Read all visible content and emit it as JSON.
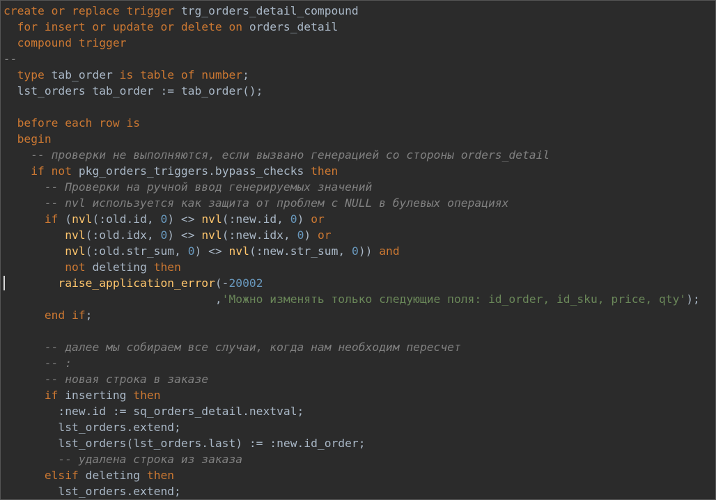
{
  "editor": {
    "language": "plsql",
    "colors": {
      "background": "#2b2b2b",
      "keyword": "#cc7832",
      "identifier": "#a9b7c6",
      "function": "#ffc66d",
      "number": "#6897bb",
      "string": "#6a8759",
      "comment": "#808080"
    },
    "lines": [
      [
        {
          "t": "kw",
          "v": "create or replace trigger "
        },
        {
          "t": "id",
          "v": "trg_orders_detail_compound"
        }
      ],
      [
        {
          "t": "plain",
          "v": "  "
        },
        {
          "t": "kw",
          "v": "for insert or update or delete on "
        },
        {
          "t": "id",
          "v": "orders_detail"
        }
      ],
      [
        {
          "t": "plain",
          "v": "  "
        },
        {
          "t": "kw",
          "v": "compound trigger"
        }
      ],
      [
        {
          "t": "cm",
          "v": "--"
        }
      ],
      [
        {
          "t": "plain",
          "v": "  "
        },
        {
          "t": "kw",
          "v": "type "
        },
        {
          "t": "id",
          "v": "tab_order "
        },
        {
          "t": "kw",
          "v": "is table of number"
        },
        {
          "t": "plain",
          "v": ";"
        }
      ],
      [
        {
          "t": "plain",
          "v": "  "
        },
        {
          "t": "id",
          "v": "lst_orders tab_order := tab_order();"
        }
      ],
      [],
      [
        {
          "t": "plain",
          "v": "  "
        },
        {
          "t": "kw",
          "v": "before each row is"
        }
      ],
      [
        {
          "t": "plain",
          "v": "  "
        },
        {
          "t": "kw",
          "v": "begin"
        }
      ],
      [
        {
          "t": "plain",
          "v": "    "
        },
        {
          "t": "cm",
          "v": "-- проверки не выполняются, если вызвано генерацией со стороны orders_detail"
        }
      ],
      [
        {
          "t": "plain",
          "v": "    "
        },
        {
          "t": "kw",
          "v": "if not "
        },
        {
          "t": "id",
          "v": "pkg_orders_triggers.bypass_checks "
        },
        {
          "t": "kw",
          "v": "then"
        }
      ],
      [
        {
          "t": "plain",
          "v": "      "
        },
        {
          "t": "cm",
          "v": "-- Проверки на ручной ввод генерируемых значений"
        }
      ],
      [
        {
          "t": "plain",
          "v": "      "
        },
        {
          "t": "cm",
          "v": "-- nvl используется как защита от проблем с NULL в булевых операциях"
        }
      ],
      [
        {
          "t": "plain",
          "v": "      "
        },
        {
          "t": "kw",
          "v": "if "
        },
        {
          "t": "plain",
          "v": "("
        },
        {
          "t": "fn",
          "v": "nvl"
        },
        {
          "t": "plain",
          "v": "(:old.id, "
        },
        {
          "t": "num",
          "v": "0"
        },
        {
          "t": "plain",
          "v": ") <> "
        },
        {
          "t": "fn",
          "v": "nvl"
        },
        {
          "t": "plain",
          "v": "(:new.id, "
        },
        {
          "t": "num",
          "v": "0"
        },
        {
          "t": "plain",
          "v": ") "
        },
        {
          "t": "kw",
          "v": "or"
        }
      ],
      [
        {
          "t": "plain",
          "v": "         "
        },
        {
          "t": "fn",
          "v": "nvl"
        },
        {
          "t": "plain",
          "v": "(:old.idx, "
        },
        {
          "t": "num",
          "v": "0"
        },
        {
          "t": "plain",
          "v": ") <> "
        },
        {
          "t": "fn",
          "v": "nvl"
        },
        {
          "t": "plain",
          "v": "(:new.idx, "
        },
        {
          "t": "num",
          "v": "0"
        },
        {
          "t": "plain",
          "v": ") "
        },
        {
          "t": "kw",
          "v": "or"
        }
      ],
      [
        {
          "t": "plain",
          "v": "         "
        },
        {
          "t": "fn",
          "v": "nvl"
        },
        {
          "t": "plain",
          "v": "(:old.str_sum, "
        },
        {
          "t": "num",
          "v": "0"
        },
        {
          "t": "plain",
          "v": ") <> "
        },
        {
          "t": "fn",
          "v": "nvl"
        },
        {
          "t": "plain",
          "v": "(:new.str_sum, "
        },
        {
          "t": "num",
          "v": "0"
        },
        {
          "t": "plain",
          "v": ")) "
        },
        {
          "t": "kw",
          "v": "and"
        }
      ],
      [
        {
          "t": "plain",
          "v": "         "
        },
        {
          "t": "kw",
          "v": "not "
        },
        {
          "t": "id",
          "v": "deleting "
        },
        {
          "t": "kw",
          "v": "then"
        }
      ],
      [
        {
          "t": "plain",
          "v": "        "
        },
        {
          "t": "fn",
          "v": "raise_application_error"
        },
        {
          "t": "plain",
          "v": "(-"
        },
        {
          "t": "num",
          "v": "20002"
        }
      ],
      [
        {
          "t": "plain",
          "v": "                               ,"
        },
        {
          "t": "str",
          "v": "'Можно изменять только следующие поля: id_order, id_sku, price, qty'"
        },
        {
          "t": "plain",
          "v": ");"
        }
      ],
      [
        {
          "t": "plain",
          "v": "      "
        },
        {
          "t": "kw",
          "v": "end if"
        },
        {
          "t": "plain",
          "v": ";"
        }
      ],
      [],
      [
        {
          "t": "plain",
          "v": "      "
        },
        {
          "t": "cm",
          "v": "-- далее мы собираем все случаи, когда нам необходим пересчет"
        }
      ],
      [
        {
          "t": "plain",
          "v": "      "
        },
        {
          "t": "cm",
          "v": "-- :"
        }
      ],
      [
        {
          "t": "plain",
          "v": "      "
        },
        {
          "t": "cm",
          "v": "-- новая строка в заказе"
        }
      ],
      [
        {
          "t": "plain",
          "v": "      "
        },
        {
          "t": "kw",
          "v": "if "
        },
        {
          "t": "id",
          "v": "inserting "
        },
        {
          "t": "kw",
          "v": "then"
        }
      ],
      [
        {
          "t": "plain",
          "v": "        "
        },
        {
          "t": "id",
          "v": ":new.id := sq_orders_detail.nextval;"
        }
      ],
      [
        {
          "t": "plain",
          "v": "        "
        },
        {
          "t": "id",
          "v": "lst_orders.extend;"
        }
      ],
      [
        {
          "t": "plain",
          "v": "        "
        },
        {
          "t": "id",
          "v": "lst_orders(lst_orders.last) := :new.id_order;"
        }
      ],
      [
        {
          "t": "plain",
          "v": "        "
        },
        {
          "t": "cm",
          "v": "-- удалена строка из заказа"
        }
      ],
      [
        {
          "t": "plain",
          "v": "      "
        },
        {
          "t": "kw",
          "v": "elsif "
        },
        {
          "t": "id",
          "v": "deleting "
        },
        {
          "t": "kw",
          "v": "then"
        }
      ],
      [
        {
          "t": "plain",
          "v": "        "
        },
        {
          "t": "id",
          "v": "lst_orders.extend;"
        }
      ]
    ]
  }
}
